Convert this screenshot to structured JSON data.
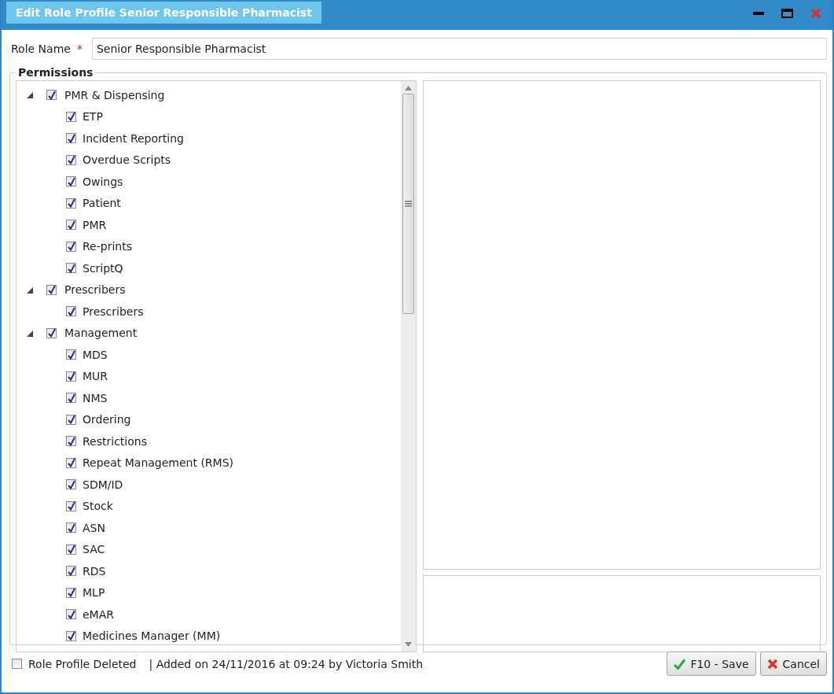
{
  "window": {
    "title": "Edit Role Profile Senior Responsible Pharmacist"
  },
  "role_name": {
    "label": "Role Name",
    "required_mark": "*",
    "value": "Senior Responsible Pharmacist"
  },
  "permissions": {
    "title": "Permissions",
    "tree": [
      {
        "label": "PMR & Dispensing",
        "checked": true,
        "expanded": true,
        "children": [
          {
            "label": "ETP",
            "checked": true
          },
          {
            "label": "Incident Reporting",
            "checked": true
          },
          {
            "label": "Overdue Scripts",
            "checked": true
          },
          {
            "label": "Owings",
            "checked": true
          },
          {
            "label": "Patient",
            "checked": true
          },
          {
            "label": "PMR",
            "checked": true
          },
          {
            "label": "Re-prints",
            "checked": true
          },
          {
            "label": "ScriptQ",
            "checked": true
          }
        ]
      },
      {
        "label": "Prescribers",
        "checked": true,
        "expanded": true,
        "children": [
          {
            "label": "Prescribers",
            "checked": true
          }
        ]
      },
      {
        "label": "Management",
        "checked": true,
        "expanded": true,
        "children": [
          {
            "label": "MDS",
            "checked": true
          },
          {
            "label": "MUR",
            "checked": true
          },
          {
            "label": "NMS",
            "checked": true
          },
          {
            "label": "Ordering",
            "checked": true
          },
          {
            "label": "Restrictions",
            "checked": true
          },
          {
            "label": "Repeat Management (RMS)",
            "checked": true
          },
          {
            "label": "SDM/ID",
            "checked": true
          },
          {
            "label": "Stock",
            "checked": true
          },
          {
            "label": "ASN",
            "checked": true
          },
          {
            "label": "SAC",
            "checked": true
          },
          {
            "label": "RDS",
            "checked": true
          },
          {
            "label": "MLP",
            "checked": true
          },
          {
            "label": "eMAR",
            "checked": true
          },
          {
            "label": "Medicines Manager (MM)",
            "checked": true
          }
        ]
      }
    ]
  },
  "footer": {
    "deleted": {
      "label": "Role Profile Deleted",
      "checked": false
    },
    "info": "| Added on 24/11/2016 at 09:24 by Victoria Smith",
    "buttons": [
      {
        "kind": "save",
        "label": "F10 - Save"
      },
      {
        "kind": "cancel",
        "label": "Cancel"
      }
    ]
  }
}
